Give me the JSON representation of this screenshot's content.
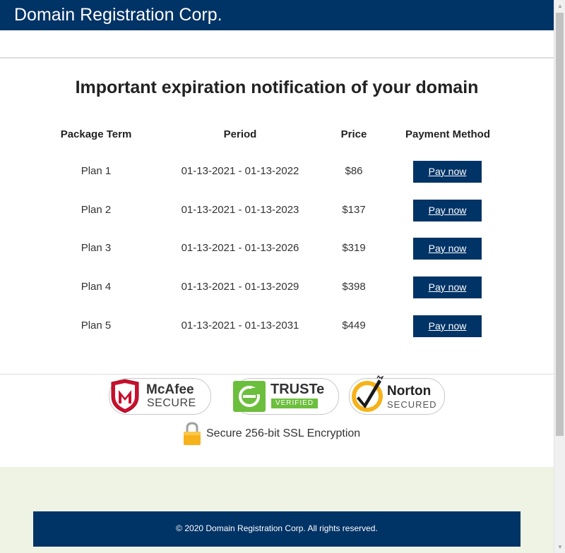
{
  "header": {
    "brand": "Domain Registration Corp."
  },
  "main": {
    "title": "Important expiration notification of your domain",
    "columns": [
      "Package Term",
      "Period",
      "Price",
      "Payment Method"
    ],
    "plans": [
      {
        "term": "Plan 1",
        "period": "01-13-2021 - 01-13-2022",
        "price": "$86",
        "action": "Pay now"
      },
      {
        "term": "Plan 2",
        "period": "01-13-2021 - 01-13-2023",
        "price": "$137",
        "action": "Pay now"
      },
      {
        "term": "Plan 3",
        "period": "01-13-2021 - 01-13-2026",
        "price": "$319",
        "action": "Pay now"
      },
      {
        "term": "Plan 4",
        "period": "01-13-2021 - 01-13-2029",
        "price": "$398",
        "action": "Pay now"
      },
      {
        "term": "Plan 5",
        "period": "01-13-2021 - 01-13-2031",
        "price": "$449",
        "action": "Pay now"
      }
    ]
  },
  "badges": {
    "mcafee": {
      "name": "McAfee",
      "label": "SECURE",
      "icon": "mcafee-shield-icon"
    },
    "truste": {
      "name": "TRUSTe",
      "label": "VERIFIED",
      "icon": "truste-logo-icon"
    },
    "norton": {
      "name": "Norton",
      "label": "SECURED",
      "icon": "norton-check-icon"
    },
    "ssl": {
      "text": "Secure 256-bit SSL Encryption",
      "icon": "padlock-icon"
    }
  },
  "footer": {
    "copyright": "© 2020 Domain Registration Corp. All rights reserved."
  },
  "colors": {
    "brand": "#003366",
    "footer_band": "#eef3e3",
    "mcafee_red": "#c8102e",
    "truste_green": "#6cbf3d",
    "norton_yellow": "#f6b21a"
  }
}
